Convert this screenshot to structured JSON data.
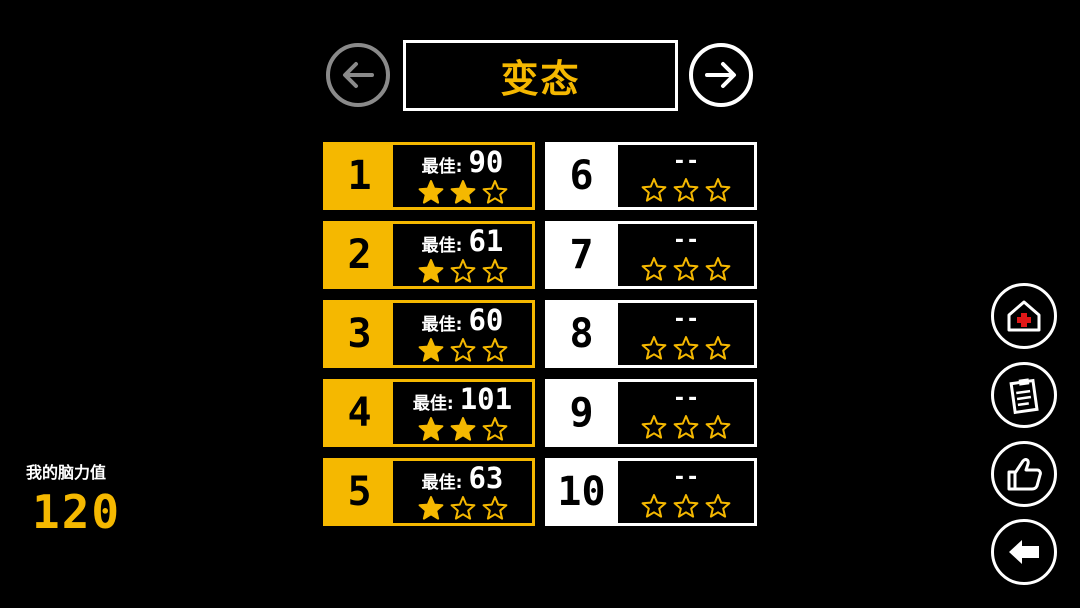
{
  "header": {
    "title": "变态",
    "prev_icon": "arrow-left-icon",
    "next_icon": "arrow-right-icon"
  },
  "levels": [
    {
      "number": "1",
      "best_label": "最佳:",
      "best_score": "90",
      "stars": 2,
      "unlocked": true
    },
    {
      "number": "2",
      "best_label": "最佳:",
      "best_score": "61",
      "stars": 1,
      "unlocked": true
    },
    {
      "number": "3",
      "best_label": "最佳:",
      "best_score": "60",
      "stars": 1,
      "unlocked": true
    },
    {
      "number": "4",
      "best_label": "最佳:",
      "best_score": "101",
      "stars": 2,
      "unlocked": true
    },
    {
      "number": "5",
      "best_label": "最佳:",
      "best_score": "63",
      "stars": 1,
      "unlocked": true
    },
    {
      "number": "6",
      "placeholder": "--",
      "stars": 0,
      "unlocked": false
    },
    {
      "number": "7",
      "placeholder": "--",
      "stars": 0,
      "unlocked": false
    },
    {
      "number": "8",
      "placeholder": "--",
      "stars": 0,
      "unlocked": false
    },
    {
      "number": "9",
      "placeholder": "--",
      "stars": 0,
      "unlocked": false
    },
    {
      "number": "10",
      "placeholder": "--",
      "stars": 0,
      "unlocked": false
    }
  ],
  "brain": {
    "label": "我的脑力值",
    "value": "120"
  },
  "side_buttons": [
    "hospital-home-icon",
    "clipboard-icon",
    "thumbs-up-icon",
    "back-arrow-icon"
  ],
  "colors": {
    "accent": "#f5b800",
    "background": "#000000",
    "foreground": "#ffffff",
    "disabled": "#8a8a8a",
    "cross": "#e01818"
  }
}
